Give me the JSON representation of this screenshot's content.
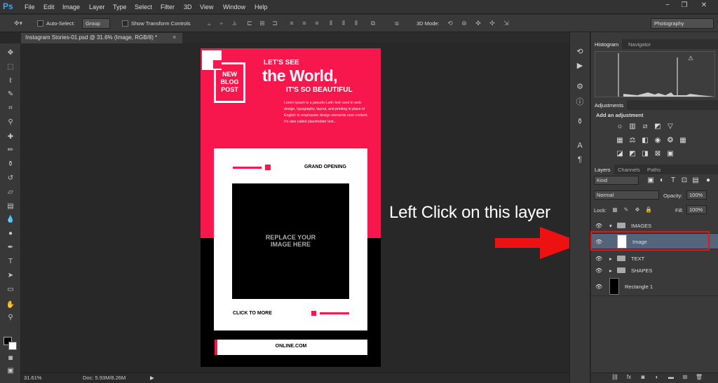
{
  "app": {
    "logo": "Ps"
  },
  "menu": [
    "File",
    "Edit",
    "Image",
    "Layer",
    "Type",
    "Select",
    "Filter",
    "3D",
    "View",
    "Window",
    "Help"
  ],
  "window_controls": {
    "minimize": "−",
    "restore": "❐",
    "close": "✕"
  },
  "options_bar": {
    "auto_select_label": "Auto-Select:",
    "auto_select_value": "Group",
    "transform_label": "Show Transform Controls",
    "mode_3d_label": "3D Mode:",
    "workspace": "Photography"
  },
  "document_tab": {
    "title": "Instagram Stories-01.psd @ 31.6% (Image, RGB/8) *",
    "close": "×"
  },
  "status": {
    "zoom": "31.61%",
    "doc_size": "Doc: 5.93M/8.26M"
  },
  "artwork": {
    "badge_line1": "NEW",
    "badge_line2": "BLOG",
    "badge_line3": "POST",
    "lets_see": "LET'S SEE",
    "headline": "the World,",
    "sub_headline": "IT'S SO BEAUTIFUL",
    "lorem": "Lorem ipsum is a pseudo-Latin text used in web design, typography, layout, and printing in place of English to emphasise design elements over content. It's also called placeholder text...",
    "grand_opening": "GRAND OPENING",
    "placeholder_line1": "REPLACE YOUR",
    "placeholder_line2": "IMAGE HERE",
    "click_more": "CLICK TO MORE",
    "online": "ONLINE.COM"
  },
  "annotation": {
    "text": "Left Click on this layer",
    "arrow_color": "#ee1111"
  },
  "panels": {
    "histogram_tabs": [
      "Histogram",
      "Navigator"
    ],
    "adjustments_tab": "Adjustments",
    "add_adjustment": "Add an adjustment",
    "layers_tabs": [
      "Layers",
      "Channels",
      "Paths"
    ],
    "filter_kind": "Kind",
    "blend_mode": "Normal",
    "opacity_label": "Opacity:",
    "opacity_value": "100%",
    "lock_label": "Lock:",
    "fill_label": "Fill:",
    "fill_value": "100%",
    "layers": [
      {
        "name": "IMAGES",
        "type": "group",
        "expanded": true
      },
      {
        "name": "Image",
        "type": "layer",
        "selected": true
      },
      {
        "name": "TEXT",
        "type": "group",
        "expanded": false
      },
      {
        "name": "SHAPES",
        "type": "group",
        "expanded": false
      },
      {
        "name": "Rectangle 1",
        "type": "shape"
      }
    ]
  },
  "colors": {
    "accent_pink": "#f7174d",
    "ps_blue": "#31a8ff",
    "highlight_red": "#ee1111"
  }
}
